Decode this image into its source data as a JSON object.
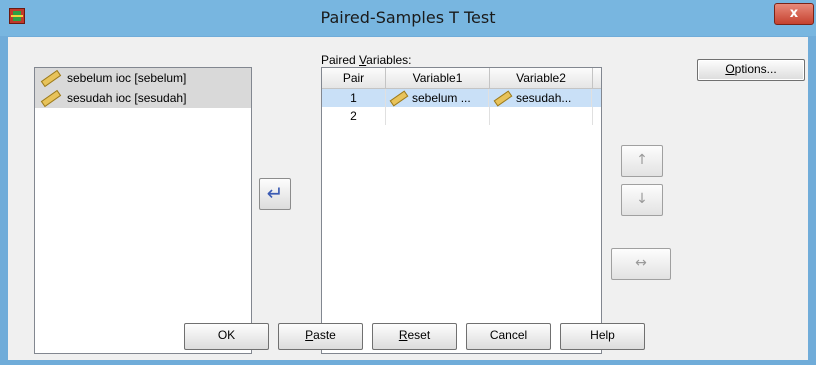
{
  "window": {
    "title": "Paired-Samples T Test",
    "close_glyph": "x",
    "icon": "spss-app-icon"
  },
  "source_list": {
    "items": [
      {
        "label": "sebelum ioc [sebelum]",
        "icon": "scale-ruler-icon"
      },
      {
        "label": "sesudah ioc [sesudah]",
        "icon": "scale-ruler-icon"
      }
    ]
  },
  "move_button": {
    "glyph": "↵",
    "icon": "move-arrow-icon"
  },
  "paired": {
    "label_before": "Paired ",
    "label_mnemonic": "V",
    "label_after": "ariables:",
    "columns": [
      "Pair",
      "Variable1",
      "Variable2"
    ],
    "rows": [
      {
        "pair": "1",
        "variable1": "sebelum ...",
        "variable2": "sesudah...",
        "selected": true
      },
      {
        "pair": "2",
        "variable1": "",
        "variable2": "",
        "selected": false
      }
    ]
  },
  "side_buttons": {
    "up_glyph": "↑",
    "down_glyph": "↓",
    "swap_glyph": "↔"
  },
  "options_button": {
    "mnemonic": "O",
    "rest": "ptions..."
  },
  "buttons": {
    "ok": "OK",
    "paste_mnemonic": "P",
    "paste_rest": "aste",
    "reset_mnemonic": "R",
    "reset_rest": "eset",
    "cancel": "Cancel",
    "help": "Help"
  },
  "colors": {
    "selection": "#c9e0f7",
    "title_bar": "#78b6e0",
    "move_arrow": "#3b5bb3"
  }
}
